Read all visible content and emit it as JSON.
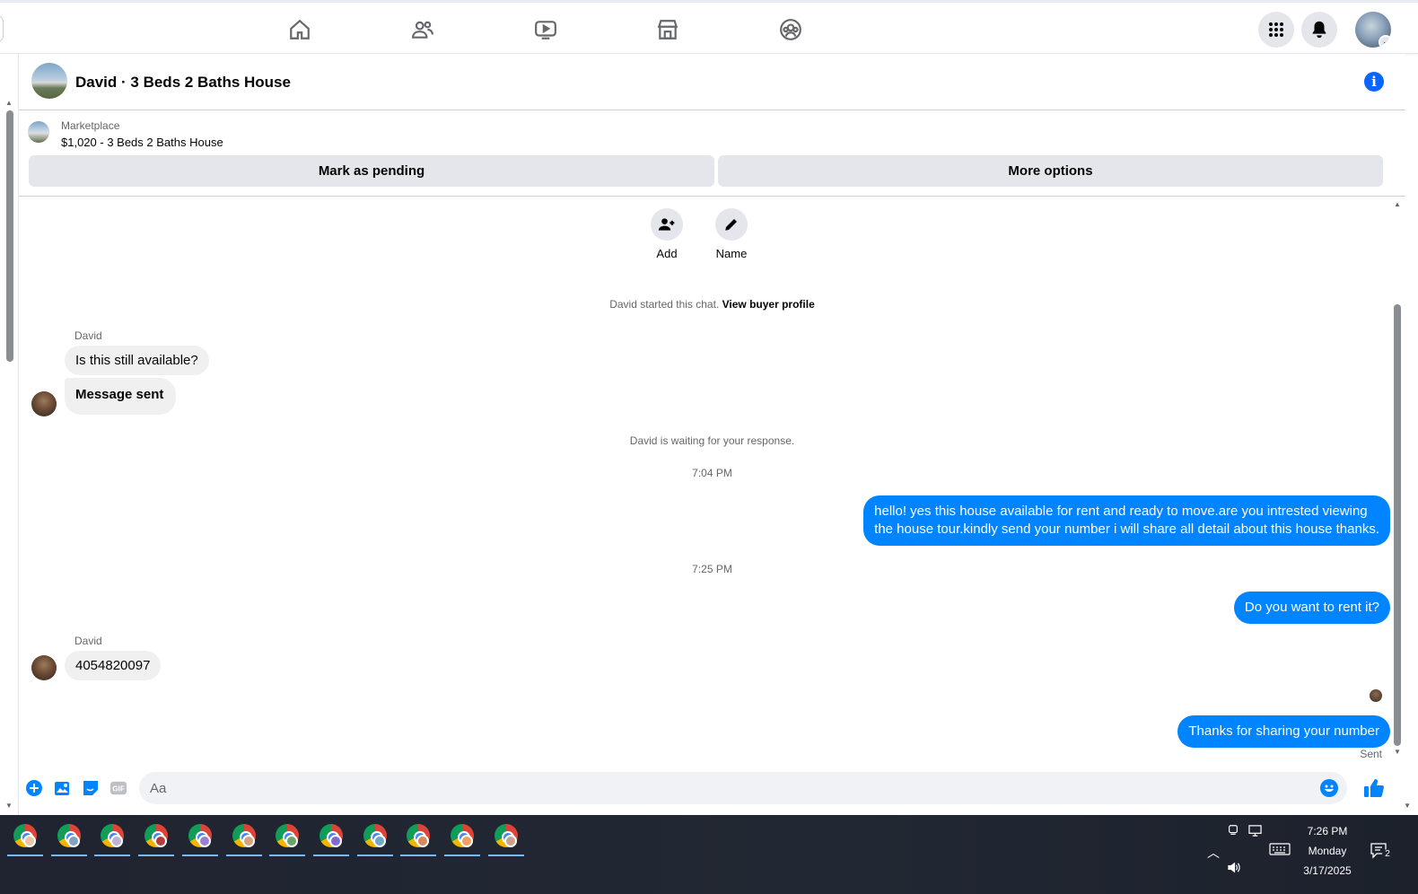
{
  "nav": {
    "icons": [
      "home-icon",
      "friends-icon",
      "video-icon",
      "marketplace-icon",
      "groups-icon"
    ],
    "right_icons": [
      "menu-grid-icon",
      "notifications-bell-icon",
      "account-avatar"
    ]
  },
  "chat": {
    "title": "David · 3 Beds 2 Baths House",
    "marketplace_label": "Marketplace",
    "listing": "$1,020 - 3 Beds 2 Baths House",
    "buttons": {
      "pending": "Mark as pending",
      "more": "More options"
    },
    "actions": {
      "add": "Add",
      "name": "Name"
    },
    "started_text": "David started this chat.",
    "buyer_profile_link": "View buyer profile",
    "waiting_text": "David is waiting for your response.",
    "messages": {
      "sender1": "David",
      "m1": "Is this still available?",
      "m2": "Message sent",
      "time1": "7:04 PM",
      "out1_line1": "hello! yes this house available for rent and ready to move.are you intrested viewing",
      "out1_line2": "the house tour.kindly send your number i will share all detail about this house thanks.",
      "time2": "7:25 PM",
      "out2": "Do you want to rent it?",
      "sender2": "David",
      "m3": "4054820097",
      "out3": "Thanks for sharing your number",
      "status": "Sent"
    },
    "composer_placeholder": "Aa"
  },
  "taskbar": {
    "app_count": 12,
    "time": "7:26 PM",
    "day": "Monday",
    "date": "3/17/2025",
    "notification_count": "2"
  },
  "colors": {
    "accent": "#0866ff",
    "outgoing_bubble": "#0084ff",
    "incoming_bubble": "#f0f0f0",
    "button_gray": "#e4e6eb",
    "taskbar": "#1f2430"
  }
}
